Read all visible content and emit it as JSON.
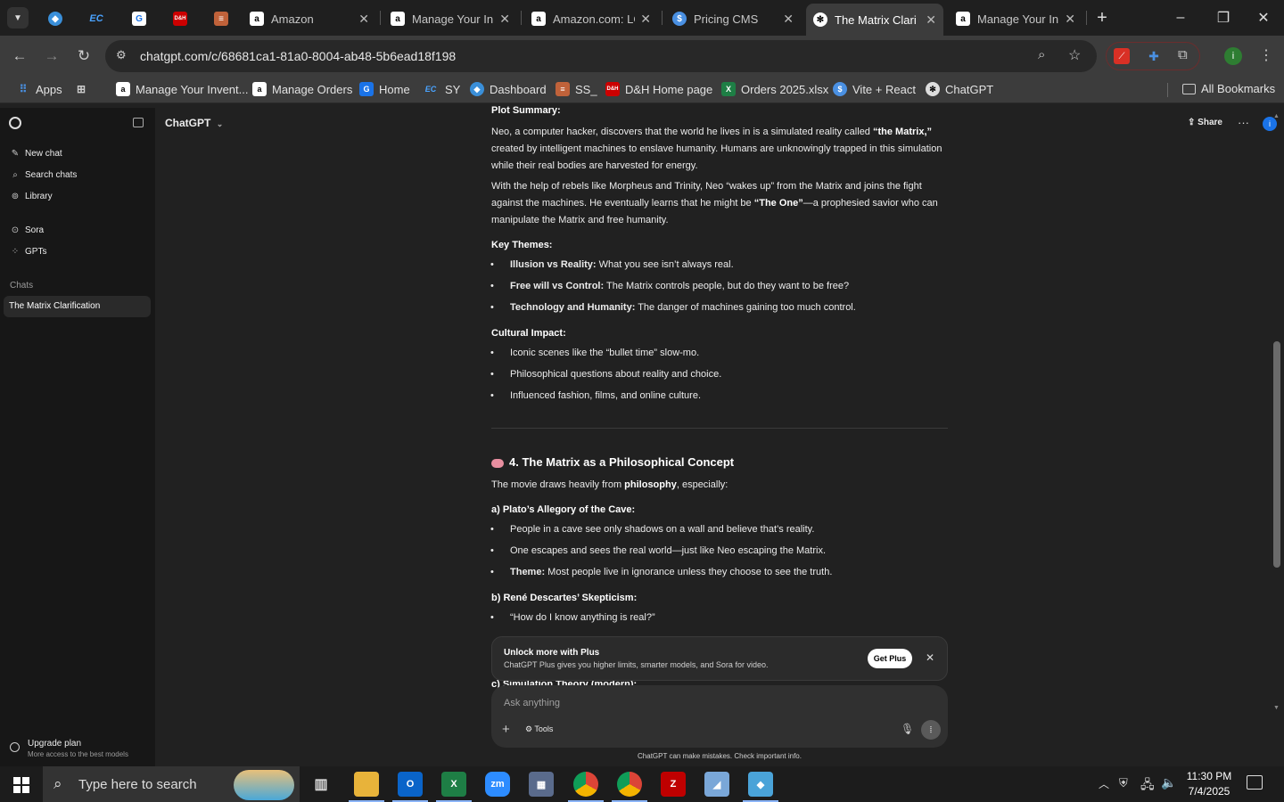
{
  "browser": {
    "tabs": [
      {
        "label": "",
        "favicon": "ec-icon"
      },
      {
        "label": "",
        "favicon": "ec-icon"
      },
      {
        "label": "",
        "favicon": "docs-icon"
      },
      {
        "label": "",
        "favicon": "dh-icon"
      },
      {
        "label": "",
        "favicon": "layers-icon"
      },
      {
        "label": "Amazon",
        "favicon": "amazon-icon"
      },
      {
        "label": "Manage Your In",
        "favicon": "amazon-icon"
      },
      {
        "label": "Amazon.com: LG",
        "favicon": "amazon-icon"
      },
      {
        "label": "Pricing CMS",
        "favicon": "dollar-icon"
      },
      {
        "label": "The Matrix Clari",
        "favicon": "chatgpt-icon"
      },
      {
        "label": "Manage Your In",
        "favicon": "amazon-icon"
      }
    ],
    "url": "chatgpt.com/c/68681ca1-81a0-8004-ab48-5b6ead18f198",
    "bookmarks": [
      {
        "label": "Apps"
      },
      {
        "label": "Manage Your Invent..."
      },
      {
        "label": "Manage Orders"
      },
      {
        "label": "Home"
      },
      {
        "label": "SY"
      },
      {
        "label": "Dashboard"
      },
      {
        "label": "SS_"
      },
      {
        "label": "D&H Home page"
      },
      {
        "label": "Orders 2025.xlsx"
      },
      {
        "label": "Vite + React"
      },
      {
        "label": "ChatGPT"
      }
    ],
    "all_bookmarks": "All Bookmarks",
    "profile_initial": "i"
  },
  "sidebar": {
    "items": [
      {
        "label": "New chat",
        "icon": "edit-icon"
      },
      {
        "label": "Search chats",
        "icon": "search-icon"
      },
      {
        "label": "Library",
        "icon": "library-icon"
      },
      {
        "label": "Sora",
        "icon": "sora-icon"
      },
      {
        "label": "GPTs",
        "icon": "grid-icon"
      }
    ],
    "section_label": "Chats",
    "active_chat": "The Matrix Clarification",
    "upgrade_title": "Upgrade plan",
    "upgrade_sub": "More access to the best models"
  },
  "header": {
    "model": "ChatGPT",
    "share": "Share"
  },
  "conversation": {
    "plot_heading": "Plot Summary:",
    "para1a": "Neo, a computer hacker, discovers that the world he lives in is a simulated reality called ",
    "para1b": "“the Matrix,”",
    "para1c": " created by intelligent machines to enslave humanity. Humans are unknowingly trapped in this simulation while their real bodies are harvested for energy.",
    "para2a": "With the help of rebels like Morpheus and Trinity, Neo “wakes up” from the Matrix and joins the fight against the machines. He eventually learns that he might be ",
    "para2b": "“The One”",
    "para2c": "—a prophesied savior who can manipulate the Matrix and free humanity.",
    "themes_heading": "Key Themes:",
    "themes": [
      {
        "bold": "Illusion vs Reality:",
        "text": " What you see isn’t always real."
      },
      {
        "bold": "Free will vs Control:",
        "text": " The Matrix controls people, but do they want to be free?"
      },
      {
        "bold": "Technology and Humanity:",
        "text": " The danger of machines gaining too much control."
      }
    ],
    "impact_heading": "Cultural Impact:",
    "impact": [
      "Iconic scenes like the “bullet time” slow-mo.",
      "Philosophical questions about reality and choice.",
      "Influenced fashion, films, and online culture."
    ],
    "section4_title": "4. The Matrix as a Philosophical Concept",
    "section4_intro_a": "The movie draws heavily from ",
    "section4_intro_b": "philosophy",
    "section4_intro_c": ", especially:",
    "plato_heading": "a) Plato’s Allegory of the Cave:",
    "plato": [
      {
        "bold": "",
        "text": "People in a cave see only shadows on a wall and believe that’s reality."
      },
      {
        "bold": "",
        "text": "One escapes and sees the real world—just like Neo escaping the Matrix."
      },
      {
        "bold": "Theme:",
        "text": " Most people live in ignorance unless they choose to see the truth."
      }
    ],
    "descartes_heading": "b) René Descartes’ Skepticism:",
    "descartes": [
      "“How do I know anything is real?”"
    ],
    "partial_heading": "c) Simulation Theory (modern):"
  },
  "upsell": {
    "title": "Unlock more with Plus",
    "sub": "ChatGPT Plus gives you higher limits, smarter models, and Sora for video.",
    "button": "Get Plus"
  },
  "composer": {
    "placeholder": "Ask anything",
    "tools": "Tools",
    "disclaimer": "ChatGPT can make mistakes. Check important info."
  },
  "taskbar": {
    "search_placeholder": "Type here to search",
    "time": "11:30 PM",
    "date": "7/4/2025"
  }
}
